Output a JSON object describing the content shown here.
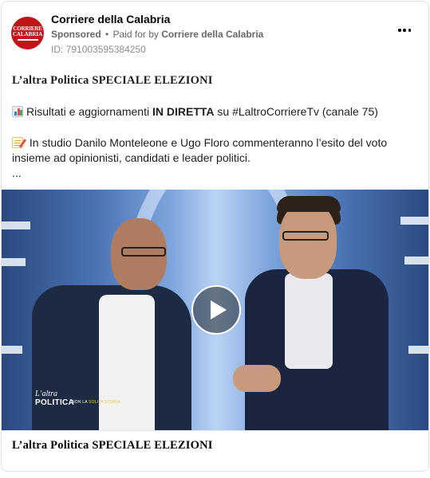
{
  "post": {
    "page_name": "Corriere della Calabria",
    "sponsored_label": "Sponsored",
    "paid_prefix": "Paid for by",
    "payer": "Corriere della Calabria",
    "id_text": "ID: 791003595384250",
    "avatar_logo": {
      "line1": "CORRIERE",
      "line2": "CALABRIA",
      "color": "#c0161a"
    }
  },
  "body": {
    "headline": "L’altra Politica SPECIALE ELEZIONI",
    "para1_prefix": "Risultati e aggiornamenti ",
    "para1_bold": "IN DIRETTA",
    "para1_suffix": " su #LaltroCorriereTv (canale 75)",
    "para2": "In studio Danilo Monteleone e Ugo Floro commenteranno l’esito del voto insieme ad opinionisti, candidati e leader politici.",
    "ellipsis": "..."
  },
  "icons": {
    "para1_icon": "bar-chart-icon",
    "para2_icon": "memo-icon",
    "menu_icon": "more-options-icon",
    "play_icon": "play-icon"
  },
  "video": {
    "logo_line1": "L’altra",
    "logo_line2": "POLITICA",
    "logo_tag_prefix": "NON LA ",
    "logo_tag_highlight": "SOLITA STORIA"
  },
  "footer": {
    "title": "L’altra Politica SPECIALE ELEZIONI"
  }
}
